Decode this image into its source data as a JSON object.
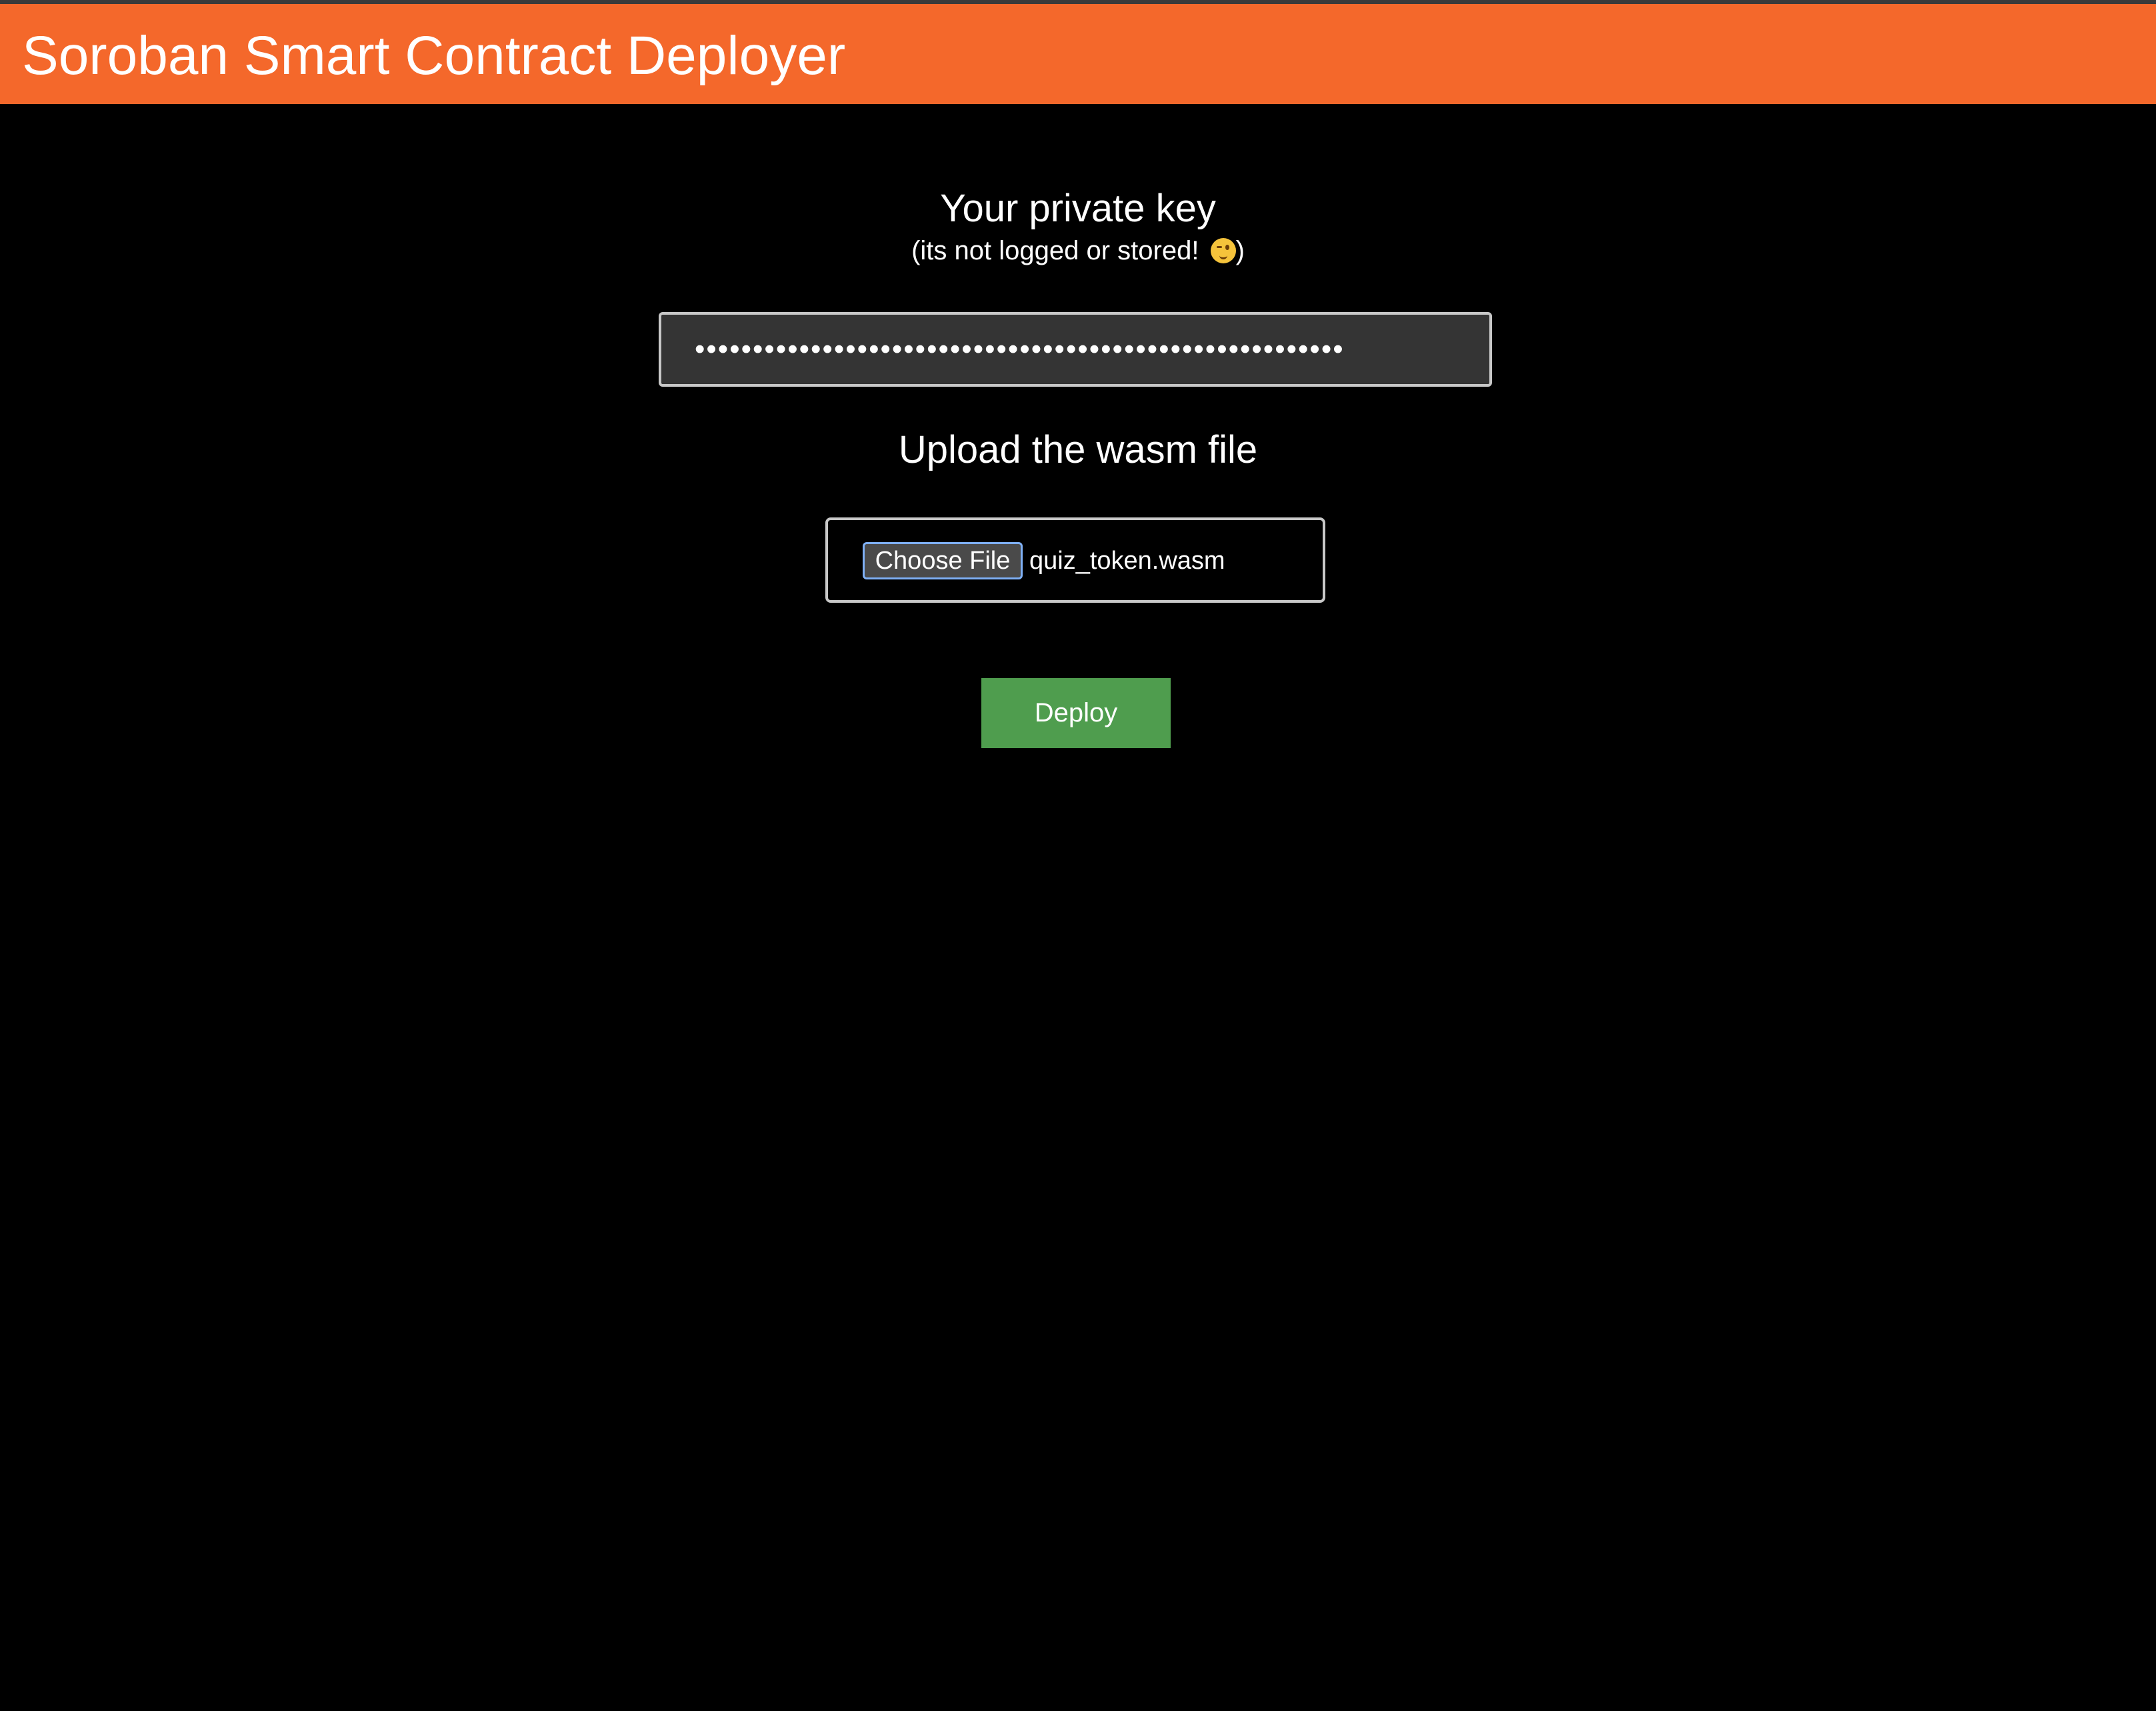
{
  "header": {
    "title": "Soroban Smart Contract Deployer"
  },
  "private_key": {
    "heading": "Your private key",
    "subtext": "(its not logged or stored! ",
    "subtext_end": ")",
    "emoji": "winking-face-icon",
    "masked_value": "••••••••••••••••••••••••••••••••••••••••••••••••••••••••"
  },
  "upload": {
    "heading": "Upload the wasm file",
    "choose_button_label": "Choose File",
    "selected_file": "quiz_token.wasm"
  },
  "deploy": {
    "label": "Deploy"
  },
  "colors": {
    "header_bg": "#f4682b",
    "page_bg": "#000000",
    "input_bg": "#343434",
    "deploy_bg": "#4f9d4e"
  }
}
